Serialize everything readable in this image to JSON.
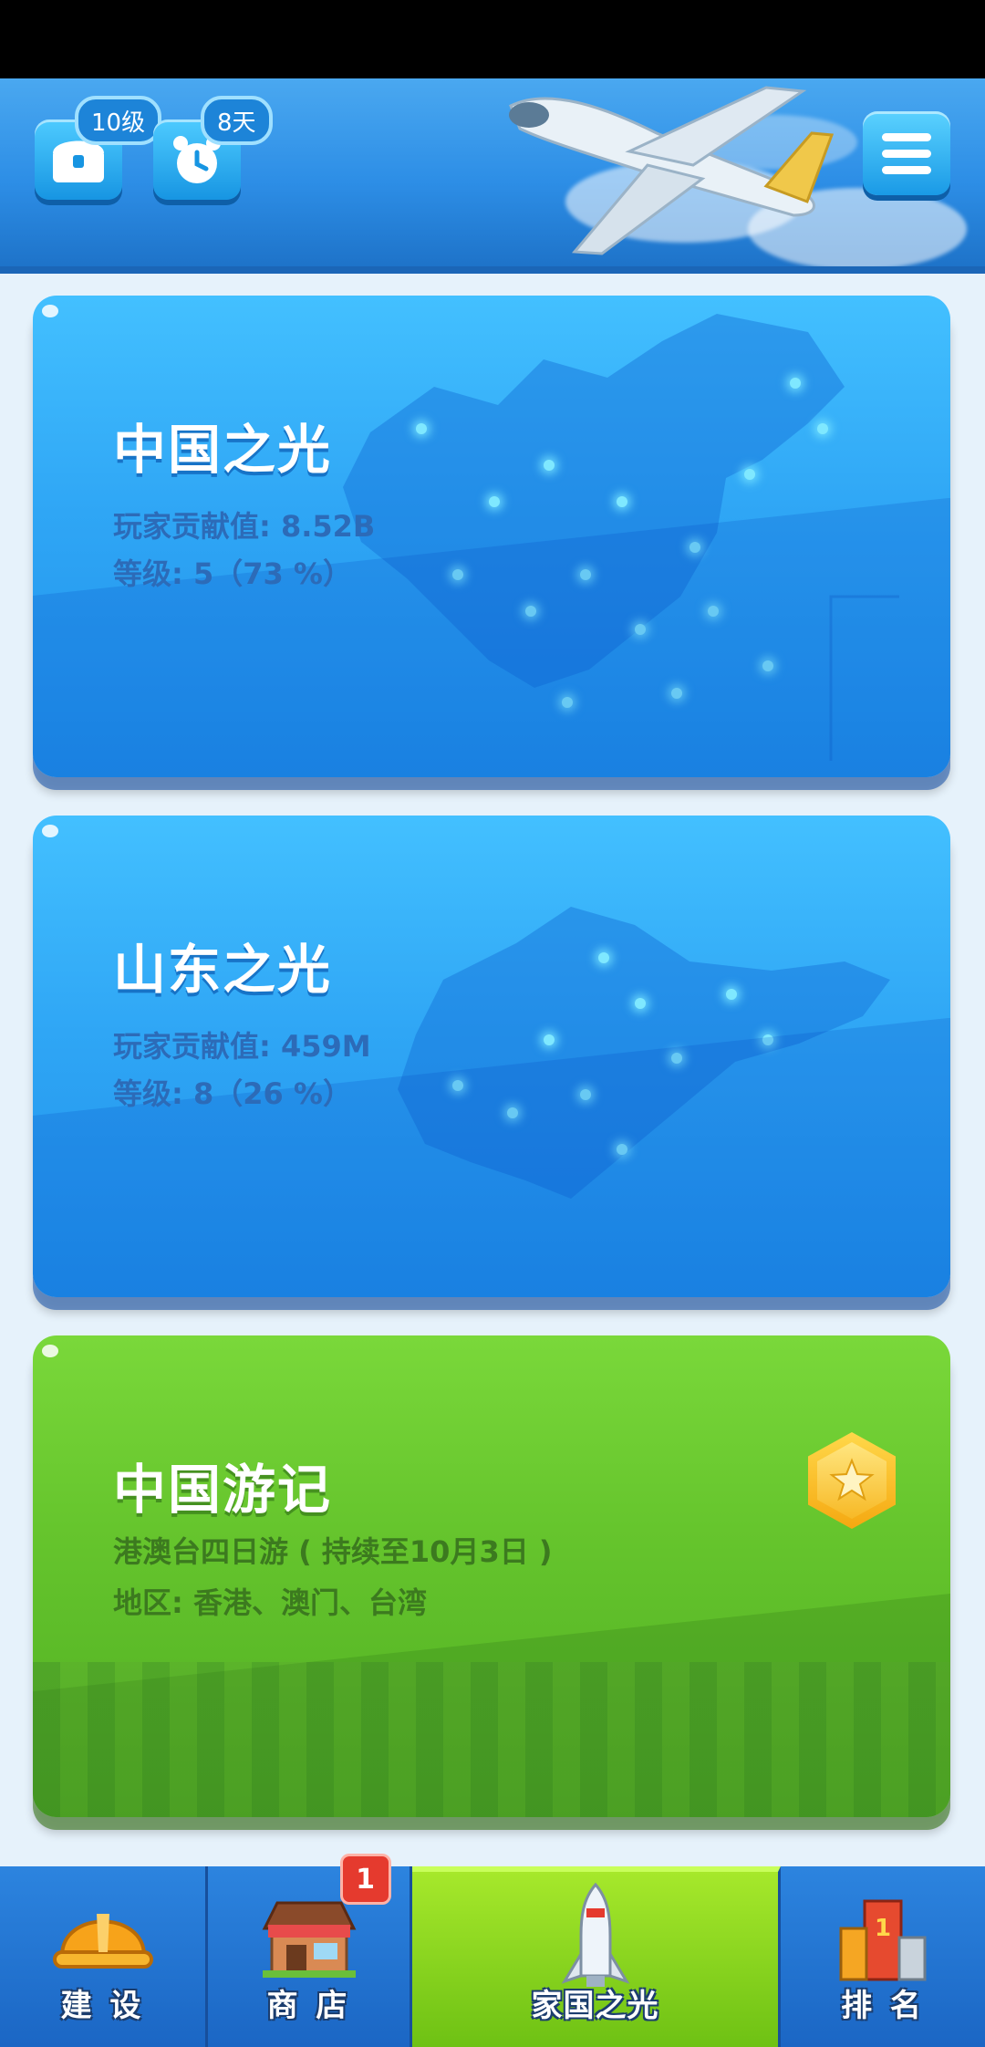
{
  "header": {
    "level_badge": "10级",
    "days_badge": "8天"
  },
  "cards": [
    {
      "title": "中国之光",
      "line1": "玩家贡献值: 8.52B",
      "line2": "等级: 5（73 %）",
      "progress_percent": 73
    },
    {
      "title": "山东之光",
      "line1": "玩家贡献值: 459M",
      "line2": "等级: 8（26 %）",
      "progress_percent": 26
    },
    {
      "title": "中国游记",
      "line1": "港澳台四日游 ( 持续至10月3日 )",
      "line2": "地区: 香港、澳门、台湾"
    }
  ],
  "bottom_nav": {
    "items": [
      {
        "label": "建 设",
        "icon": "hard-hat-icon"
      },
      {
        "label": "商 店",
        "icon": "shop-icon",
        "badge": "1"
      },
      {
        "label": "家国之光",
        "icon": "rocket-icon",
        "active": true
      },
      {
        "label": "排 名",
        "icon": "podium-icon"
      }
    ]
  },
  "colors": {
    "header": "#2d8ee6",
    "card_blue": "#2fa6f5",
    "card_green": "#66c52d",
    "nav_active": "#8ad41f",
    "badge_red": "#e53a2e"
  }
}
